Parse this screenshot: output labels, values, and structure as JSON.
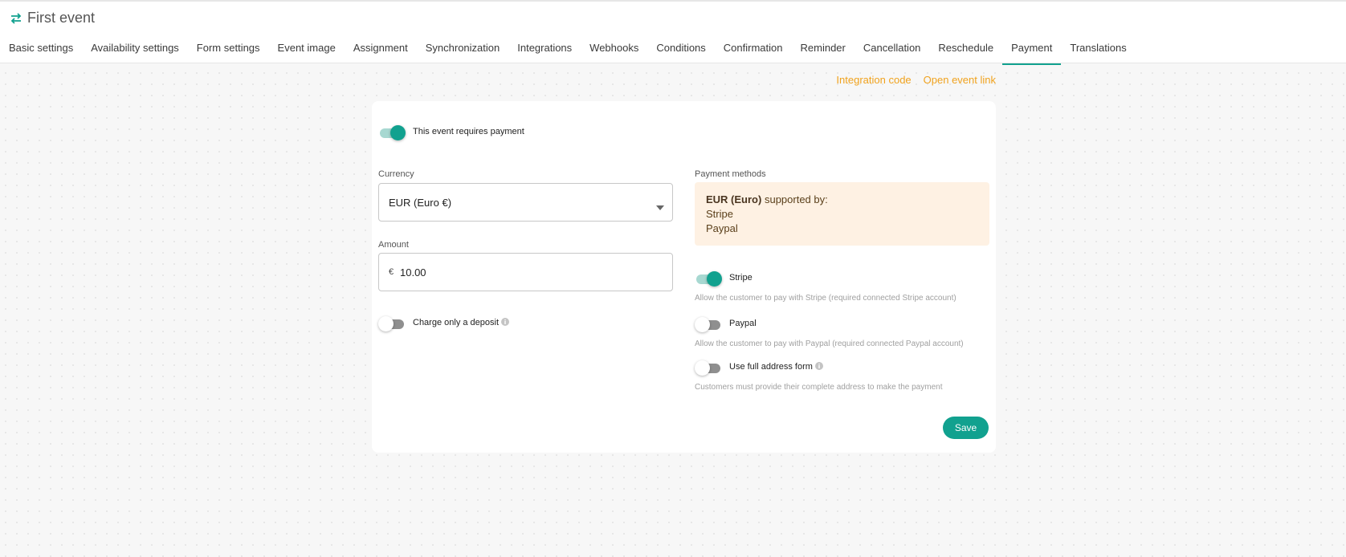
{
  "header": {
    "title": "First event",
    "tabs": [
      {
        "label": "Basic settings"
      },
      {
        "label": "Availability settings"
      },
      {
        "label": "Form settings"
      },
      {
        "label": "Event image"
      },
      {
        "label": "Assignment"
      },
      {
        "label": "Synchronization"
      },
      {
        "label": "Integrations"
      },
      {
        "label": "Webhooks"
      },
      {
        "label": "Conditions"
      },
      {
        "label": "Confirmation"
      },
      {
        "label": "Reminder"
      },
      {
        "label": "Cancellation"
      },
      {
        "label": "Reschedule"
      },
      {
        "label": "Payment"
      },
      {
        "label": "Translations"
      }
    ],
    "active_tab": "Payment"
  },
  "links": {
    "integration_code": "Integration code",
    "open_event_link": "Open event link"
  },
  "payment": {
    "requires_payment_label": "This event requires payment",
    "requires_payment": true,
    "currency_label": "Currency",
    "currency_value": "EUR (Euro €)",
    "amount_label": "Amount",
    "amount_symbol": "€",
    "amount_value": "10.00",
    "deposit_label": "Charge only a deposit",
    "deposit": false,
    "methods_label": "Payment methods",
    "supported_currency": "EUR (Euro)",
    "supported_by": "supported by:",
    "supported_list": [
      "Stripe",
      "Paypal"
    ],
    "stripe_label": "Stripe",
    "stripe_enabled": true,
    "stripe_hint": "Allow the customer to pay with Stripe (required connected Stripe account)",
    "paypal_label": "Paypal",
    "paypal_enabled": false,
    "paypal_hint": "Allow the customer to pay with Paypal (required connected Paypal account)",
    "full_address_label": "Use full address form",
    "full_address_enabled": false,
    "full_address_hint": "Customers must provide their complete address to make the payment",
    "save_label": "Save"
  },
  "colors": {
    "accent": "#11a18f",
    "link": "#f0a21d",
    "info_bg": "#fef1e3"
  },
  "icons": {
    "title": "swap-arrows-icon",
    "dropdown": "caret-down-icon",
    "info": "info-circle-icon"
  }
}
